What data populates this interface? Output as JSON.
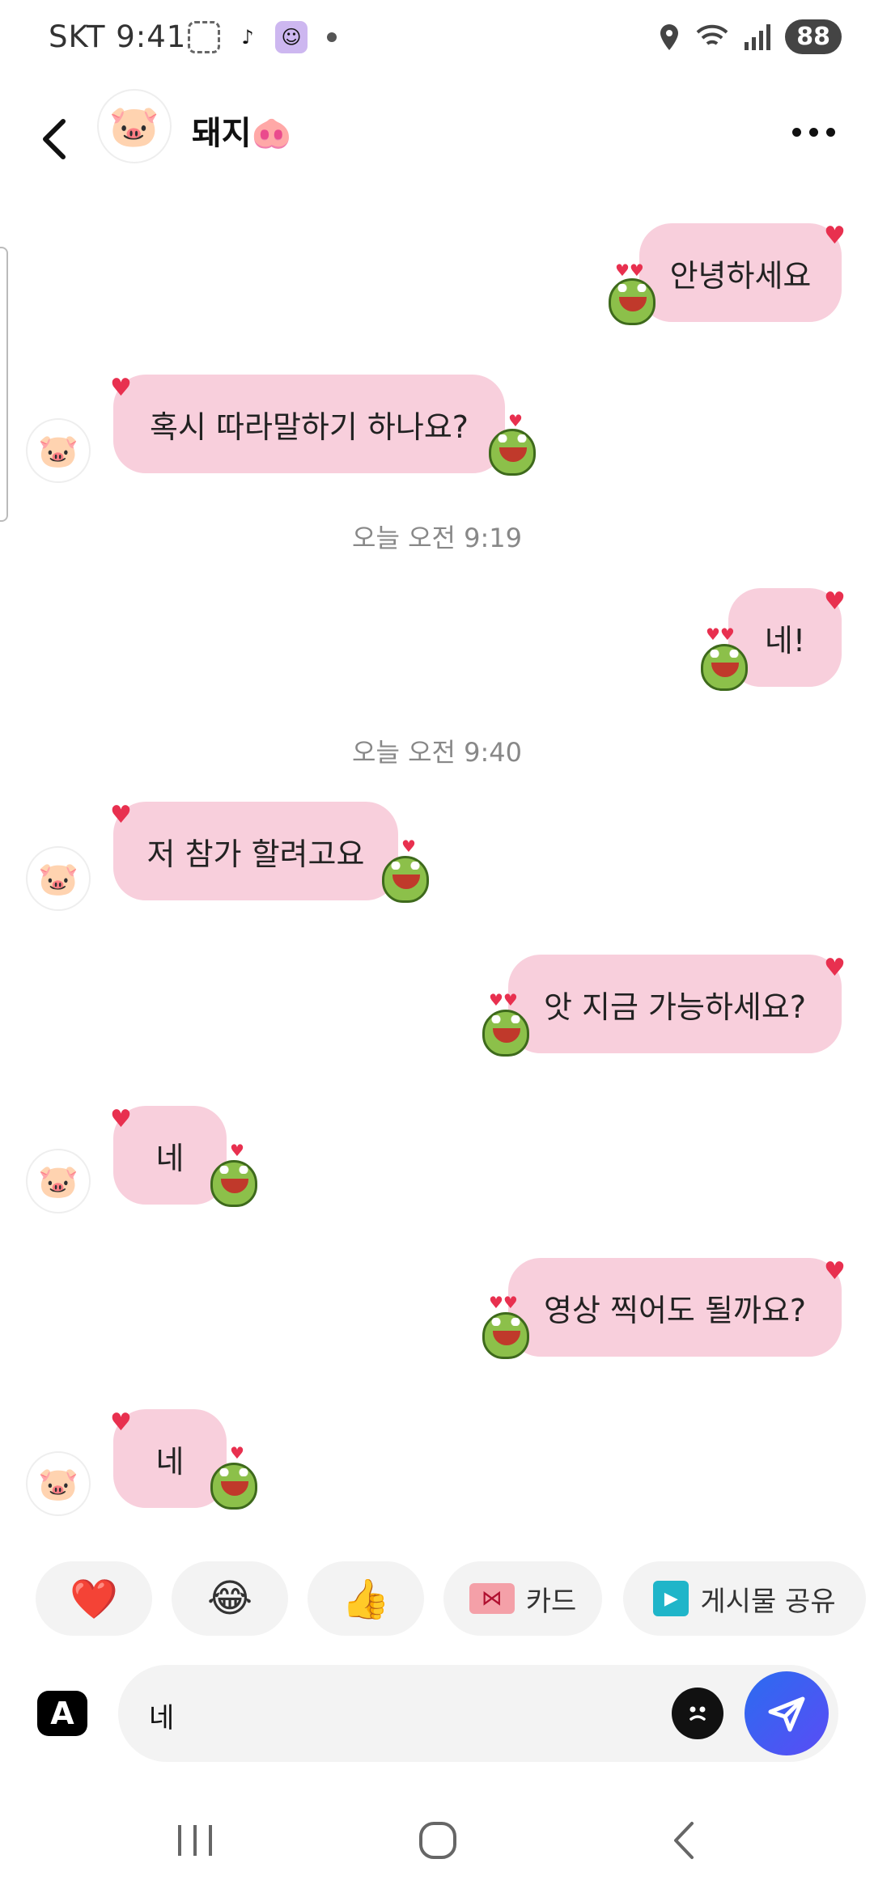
{
  "status_bar": {
    "time": "SKT 9:41",
    "battery": "88"
  },
  "header": {
    "contact_name": "돼지🐽",
    "avatar_emoji": "🐷"
  },
  "messages": [
    {
      "side": "right",
      "text": "안녕하세요"
    },
    {
      "side": "left",
      "text": "혹시 따라말하기 하나요?"
    },
    {
      "side": "time",
      "text": "오늘 오전 9:19"
    },
    {
      "side": "right",
      "text": "네!"
    },
    {
      "side": "time",
      "text": "오늘 오전 9:40"
    },
    {
      "side": "left",
      "text": "저 참가 할려고요"
    },
    {
      "side": "right",
      "text": "앗 지금 가능하세요?"
    },
    {
      "side": "left",
      "text": "네"
    },
    {
      "side": "right",
      "text": "영상 찍어도 될까요?"
    },
    {
      "side": "left",
      "text": "네"
    }
  ],
  "quick_reactions": {
    "heart": "❤️",
    "laugh": "😂",
    "thumbs": "👍",
    "card_label": "카드",
    "share_label": "게시물 공유"
  },
  "composer": {
    "font_button": "A",
    "input_value": "네"
  },
  "colors": {
    "bubble": "#f8cfdc",
    "send_button": "#3b5cf2",
    "heart": "#e8304f"
  }
}
